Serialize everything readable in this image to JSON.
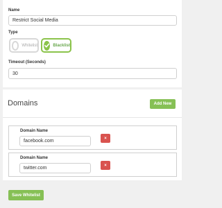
{
  "form": {
    "name_label": "Name",
    "name_value": "Restrict Social Media",
    "type_label": "Type",
    "type_options": [
      {
        "label": "Whitelist",
        "selected": false
      },
      {
        "label": "Blacklist",
        "selected": true
      }
    ],
    "timeout_label": "Timeout (Seconds)",
    "timeout_value": "30"
  },
  "domains": {
    "title": "Domains",
    "add_label": "Add New",
    "items": [
      {
        "field_label": "Domain Name",
        "value": "facebook.com",
        "delete_icon": "×"
      },
      {
        "field_label": "Domain Name",
        "value": "twitter.com",
        "delete_icon": "×"
      }
    ]
  },
  "save_label": "Save Whitelist",
  "colors": {
    "accent": "#86c055",
    "danger": "#d9534f"
  }
}
